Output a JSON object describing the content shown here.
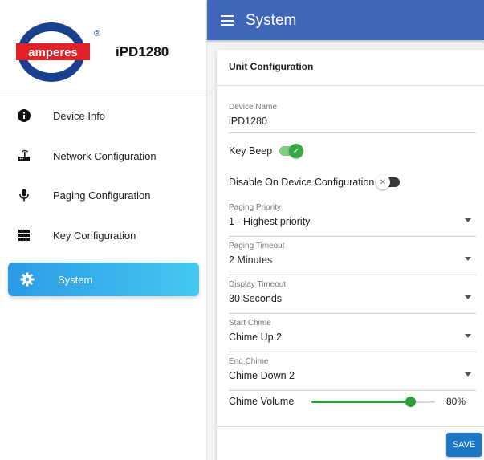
{
  "sidebar": {
    "logo_text": "amperes",
    "logo_mark": "®",
    "device_title": "iPD1280",
    "items": [
      {
        "label": "Device Info",
        "icon": "info-icon"
      },
      {
        "label": "Network Configuration",
        "icon": "router-icon"
      },
      {
        "label": "Paging Configuration",
        "icon": "microphone-icon"
      },
      {
        "label": "Key Configuration",
        "icon": "grid-icon"
      },
      {
        "label": "System",
        "icon": "gear-icon",
        "active": true
      }
    ]
  },
  "header": {
    "title": "System"
  },
  "card": {
    "title": "Unit Configuration",
    "device_name": {
      "label": "Device Name",
      "value": "iPD1280"
    },
    "key_beep": {
      "label": "Key Beep",
      "checked": true
    },
    "disable_config": {
      "label": "Disable On Device Configuration",
      "checked": false
    },
    "paging_priority": {
      "label": "Paging Priority",
      "value": "1 - Highest priority"
    },
    "paging_timeout": {
      "label": "Paging Timeout",
      "value": "2 Minutes"
    },
    "display_timeout": {
      "label": "Display Timeout",
      "value": "30 Seconds"
    },
    "start_chime": {
      "label": "Start Chime",
      "value": "Chime Up 2"
    },
    "end_chime": {
      "label": "End Chime",
      "value": "Chime Down 2"
    },
    "chime_volume": {
      "label": "Chime Volume",
      "value_text": "80%",
      "value": 80
    }
  },
  "actions": {
    "save_label": "SAVE"
  },
  "colors": {
    "header": "#3f66b8",
    "active_nav_start": "#2c9be6",
    "active_nav_end": "#45c9ef",
    "toggle_on": "#35a845",
    "slider": "#2e9e3f",
    "save_button": "#1d77c7",
    "logo_blue": "#1b3f8f",
    "logo_red": "#e02127"
  }
}
